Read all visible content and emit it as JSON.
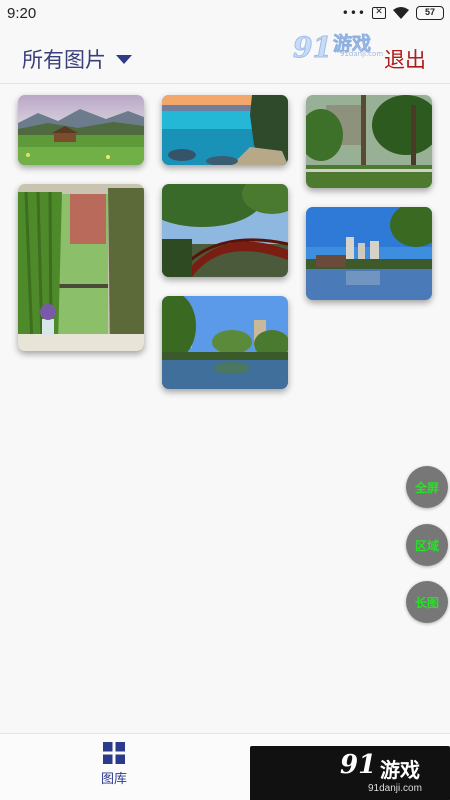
{
  "status_bar": {
    "time": "9:20",
    "more_dots": "•••",
    "sim_mark": "✕",
    "battery_level": "57"
  },
  "header": {
    "title": "所有图片",
    "exit_label": "退出"
  },
  "watermark": {
    "brand_num": "91",
    "brand_text": "游戏",
    "url": "91danji.com"
  },
  "gallery": {
    "photos": [
      {
        "name": "meadow-cabin-mountains"
      },
      {
        "name": "turquoise-lake-shore"
      },
      {
        "name": "garden-trees-fence"
      },
      {
        "name": "window-green-curtains-lavender"
      },
      {
        "name": "red-arch-bridge"
      },
      {
        "name": "city-lake-reflection"
      },
      {
        "name": "park-pond-trees"
      }
    ]
  },
  "fab": {
    "fullscreen": "全屏",
    "region": "区域",
    "longshot": "长图"
  },
  "bottom_nav": {
    "gallery_label": "图库"
  },
  "colors": {
    "title": "#3a3f7a",
    "exit": "#b01a1a",
    "fab_bg": "#777777",
    "fab_text": "#28e028",
    "nav_active": "#2c3a8c"
  }
}
